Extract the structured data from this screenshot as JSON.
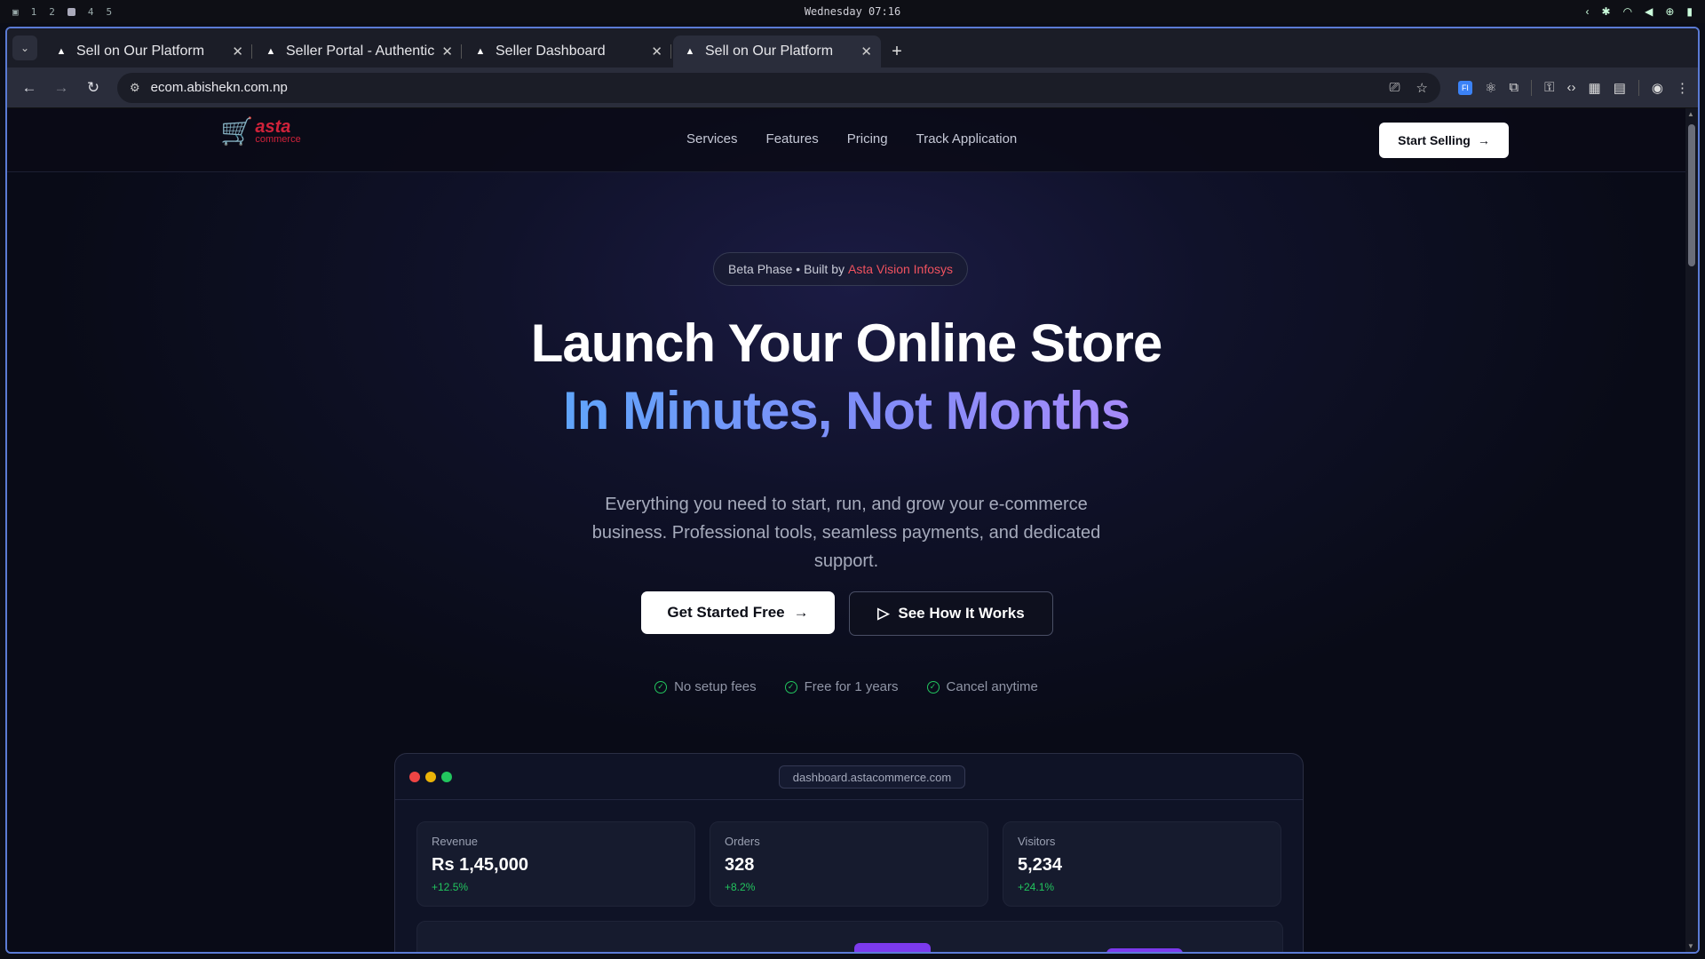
{
  "system_bar": {
    "workspaces": [
      "1",
      "2",
      "4",
      "5"
    ],
    "clock": "Wednesday 07:16"
  },
  "browser": {
    "tabs": [
      {
        "title": "Sell on Our Platform",
        "active": false
      },
      {
        "title": "Seller Portal - Authentic",
        "active": false
      },
      {
        "title": "Seller Dashboard",
        "active": false
      },
      {
        "title": "Sell on Our Platform",
        "active": true
      }
    ],
    "url": "ecom.abishekn.com.np"
  },
  "page": {
    "logo": {
      "word": "asta",
      "sub": "commerce"
    },
    "nav": [
      "Services",
      "Features",
      "Pricing",
      "Track Application"
    ],
    "start_selling": "Start Selling",
    "badge": {
      "prefix": "Beta Phase • Built by",
      "brand": "Asta Vision Infosys"
    },
    "headline1": "Launch Your Online Store",
    "headline2": "In Minutes, Not Months",
    "subtitle": "Everything you need to start, run, and grow your e-commerce business. Professional tools, seamless payments, and dedicated support.",
    "cta_primary": "Get Started Free",
    "cta_secondary": "See How It Works",
    "perks": [
      "No setup fees",
      "Free for 1 years",
      "Cancel anytime"
    ],
    "dashboard": {
      "url": "dashboard.astacommerce.com",
      "stats": [
        {
          "label": "Revenue",
          "value": "Rs 1,45,000",
          "delta": "+12.5%"
        },
        {
          "label": "Orders",
          "value": "328",
          "delta": "+8.2%"
        },
        {
          "label": "Visitors",
          "value": "5,234",
          "delta": "+24.1%"
        }
      ]
    }
  },
  "colors": {
    "accent_red": "#f0525f",
    "success": "#22c55e",
    "bar_purple": "#7c3aed",
    "window_border": "#5b7bd5"
  }
}
